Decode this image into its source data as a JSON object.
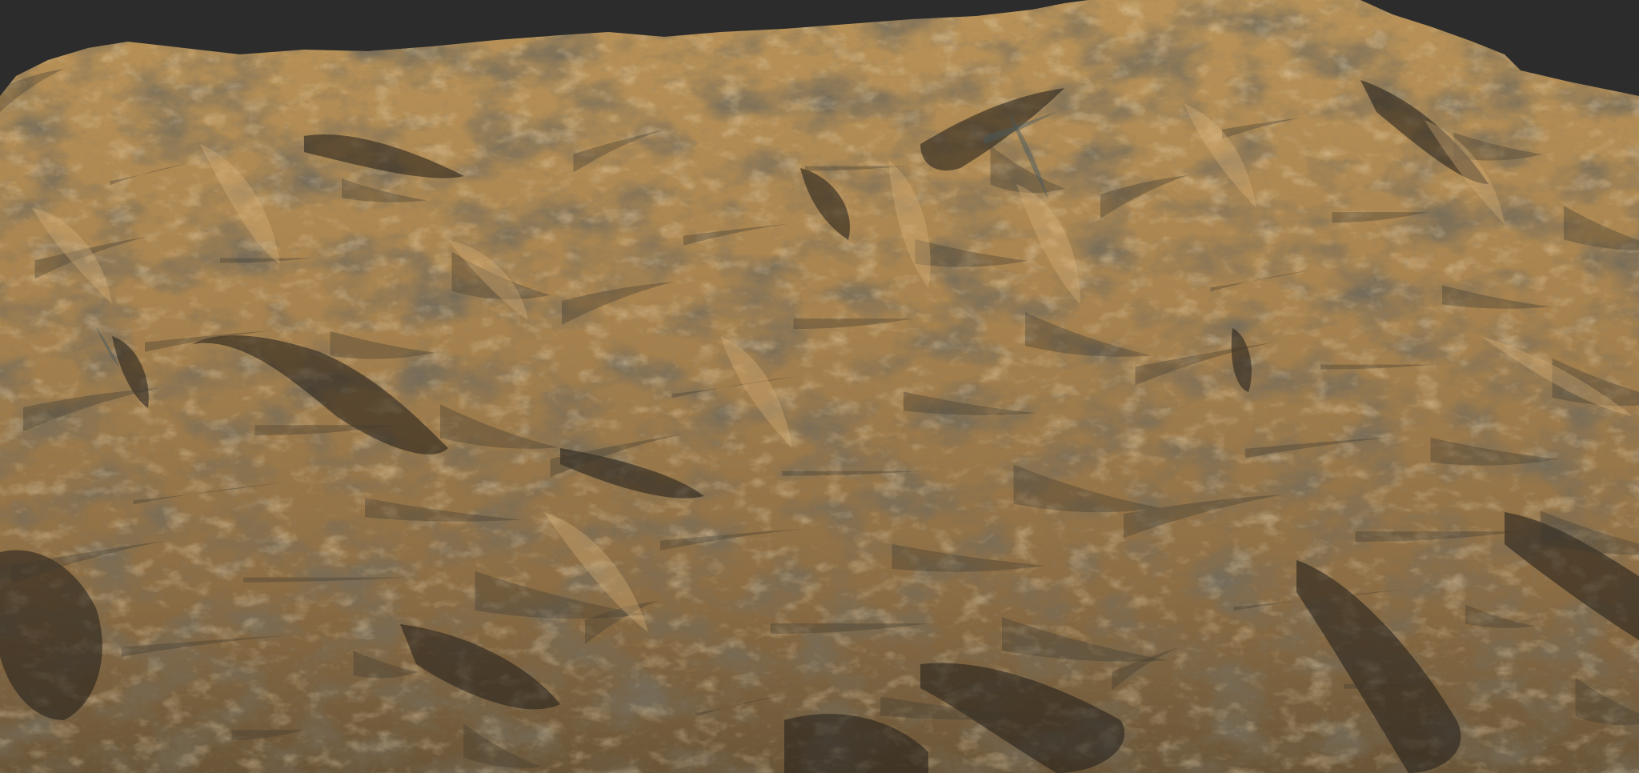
{
  "scene": {
    "background_color": "#2f2f2f",
    "terrain_colors": {
      "sunlit": "#c69a5c",
      "highlight": "#dcb57a",
      "midtone": "#9c7a4a",
      "shadow": "#3f3a2e",
      "deep_shadow": "#1f1c18",
      "bluish_shadow": "#4a5a5e"
    }
  }
}
